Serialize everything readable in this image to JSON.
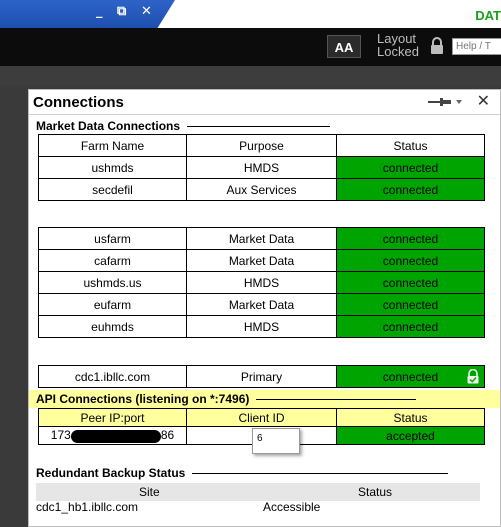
{
  "window": {
    "minimize_glyph": "_",
    "restore_glyph": "⧉",
    "close_glyph": "✕",
    "brand_text": "DAT"
  },
  "toolbar": {
    "font_button_label": "AA",
    "layout_line1": "Layout",
    "layout_line2": "Locked",
    "help_placeholder": "Help / T"
  },
  "panel": {
    "title": "Connections",
    "close_glyph": "✕"
  },
  "market_data": {
    "section_title": "Market Data Connections",
    "headers": [
      "Farm Name",
      "Purpose",
      "Status"
    ],
    "group1": [
      {
        "farm": "ushmds",
        "purpose": "HMDS",
        "status": "connected"
      },
      {
        "farm": "secdefil",
        "purpose": "Aux Services",
        "status": "connected"
      }
    ],
    "group2": [
      {
        "farm": "usfarm",
        "purpose": "Market Data",
        "status": "connected"
      },
      {
        "farm": "cafarm",
        "purpose": "Market Data",
        "status": "connected"
      },
      {
        "farm": "ushmds.us",
        "purpose": "HMDS",
        "status": "connected"
      },
      {
        "farm": "eufarm",
        "purpose": "Market Data",
        "status": "connected"
      },
      {
        "farm": "euhmds",
        "purpose": "HMDS",
        "status": "connected"
      }
    ],
    "primary": {
      "farm": "cdc1.ibllc.com",
      "purpose": "Primary",
      "status": "connected"
    }
  },
  "api": {
    "section_title": "API Connections (listening on *:7496)",
    "headers": [
      "Peer IP:port",
      "Client ID",
      "Status"
    ],
    "row": {
      "ip_prefix": "173",
      "ip_suffix": "86",
      "client_id": "",
      "status": "accepted"
    },
    "tooltip": "6"
  },
  "redundant": {
    "section_title": "Redundant Backup Status",
    "headers": [
      "Site",
      "Status"
    ],
    "row": {
      "site": "cdc1_hb1.ibllc.com",
      "status": "Accessible"
    }
  },
  "colors": {
    "connected": "#00a400",
    "api_header": "#ffff9e",
    "title_blue": "#2d63c8",
    "brand_green": "#1aa21a"
  }
}
